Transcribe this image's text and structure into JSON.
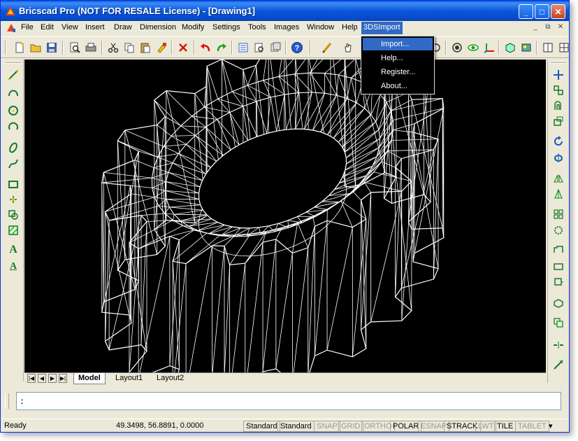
{
  "window": {
    "title": "Bricscad Pro (NOT FOR RESALE License) - [Drawing1]",
    "accent": "#0a58d8"
  },
  "titlebar_buttons": {
    "minimize": "_",
    "maximize": "□",
    "close": "✕"
  },
  "menu": {
    "items": [
      "File",
      "Edit",
      "View",
      "Insert",
      "Draw",
      "Dimension",
      "Modify",
      "Settings",
      "Tools",
      "Images",
      "Window",
      "Help",
      "3DSImport"
    ],
    "active_item": "3DSImport",
    "mdi_buttons": [
      "_",
      "⧉",
      "✕"
    ]
  },
  "dropdown": {
    "items": [
      "Import...",
      "Help...",
      "Register...",
      "About..."
    ],
    "selected": "Import..."
  },
  "toolbar": {
    "icons": [
      "new-file-icon",
      "open-folder-icon",
      "save-icon",
      "print-preview-icon",
      "print-icon",
      "cut-icon",
      "copy-icon",
      "paste-icon",
      "match-properties-icon",
      "delete-icon",
      "undo-icon",
      "redo-icon",
      "properties-icon",
      "design-center-icon",
      "layers-icon",
      "help-icon",
      "draw-pencil-icon",
      "pan-icon",
      "redraw-icon",
      "orbit-icon",
      "view-icon",
      "ucs-icon",
      "shade-icon",
      "render-icon",
      "tile-viewports-icon",
      "viewport-icon"
    ]
  },
  "left_toolbar": {
    "icons": [
      "line-icon",
      "polyline-icon",
      "circle-icon",
      "arc-icon",
      "ellipse-icon",
      "spline-icon",
      "rectangle-icon",
      "point-icon",
      "insert-block-icon",
      "hatch-icon",
      "text-icon",
      "multiline-text-icon"
    ]
  },
  "right_toolbar": {
    "icons": [
      "move-icon",
      "copy-object-icon",
      "offset-icon",
      "scale-icon",
      "rotate-icon",
      "rotate-3d-icon",
      "mirror-icon",
      "mirror-3d-icon",
      "array-icon",
      "explode-icon",
      "stretch-icon",
      "trim-icon",
      "extend-icon",
      "fillet-icon",
      "chamfer-icon",
      "break-icon",
      "lengthen-icon"
    ]
  },
  "layout_tabs": {
    "tabs": [
      "Model",
      "Layout1",
      "Layout2"
    ],
    "active": "Model",
    "nav": [
      "|◀",
      "◀",
      "▶",
      "▶|"
    ]
  },
  "command_line": {
    "prompt": ":"
  },
  "statusbar": {
    "ready": "Ready",
    "coords": "49.3498, 56.8891, 0.0000",
    "panes": [
      {
        "label": "Standard",
        "on": true
      },
      {
        "label": "Standard",
        "on": true
      },
      {
        "label": "SNAP",
        "on": false
      },
      {
        "label": "GRID",
        "on": false
      },
      {
        "label": "ORTHO",
        "on": false
      },
      {
        "label": "POLAR",
        "on": true
      },
      {
        "label": "ESNAP",
        "on": false
      },
      {
        "label": "STRACK",
        "on": true
      },
      {
        "label": "LWT",
        "on": false
      },
      {
        "label": "TILE",
        "on": true
      },
      {
        "label": "TABLET",
        "on": false
      }
    ],
    "dropdown_arrow": "▾"
  },
  "drawing": {
    "description_color": "#ffffff",
    "background": "#000000"
  }
}
